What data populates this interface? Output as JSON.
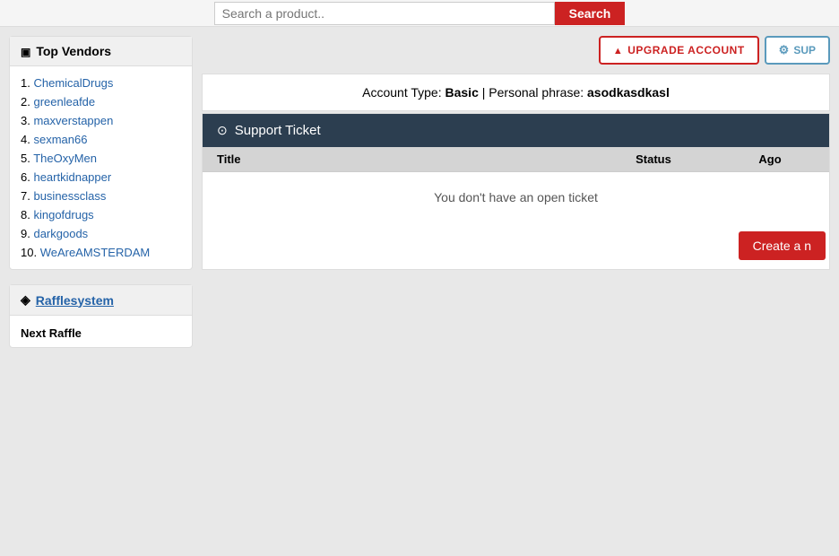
{
  "topbar": {
    "search_placeholder": "Search a product..",
    "search_button_label": "Search"
  },
  "header_buttons": {
    "upgrade_label": "Upgrade Account",
    "support_label": "SUP"
  },
  "account_info": {
    "prefix": "Account Type:",
    "type": "Basic",
    "separator": "| Personal phrase:",
    "phrase": "asodkasdkasl"
  },
  "support_ticket": {
    "section_title": "Support Ticket",
    "columns": {
      "title": "Title",
      "status": "Status",
      "ago": "Ago"
    },
    "empty_message": "You don't have an open ticket",
    "create_button": "Create a n"
  },
  "sidebar": {
    "top_vendors": {
      "header": "Top Vendors",
      "vendors": [
        {
          "rank": "1",
          "name": "ChemicalDrugs"
        },
        {
          "rank": "2",
          "name": "greenleafde"
        },
        {
          "rank": "3",
          "name": "maxverstappen"
        },
        {
          "rank": "4",
          "name": "sexman66"
        },
        {
          "rank": "5",
          "name": "TheOxyMen"
        },
        {
          "rank": "6",
          "name": "heartkidnapper"
        },
        {
          "rank": "7",
          "name": "businessclass"
        },
        {
          "rank": "8",
          "name": "kingofdrugs"
        },
        {
          "rank": "9",
          "name": "darkgoods"
        },
        {
          "rank": "10",
          "name": "WeAreAMSTERDAM"
        }
      ]
    },
    "raffle": {
      "header": "Rafflesystem",
      "next_raffle_label": "Next Raffle"
    }
  }
}
